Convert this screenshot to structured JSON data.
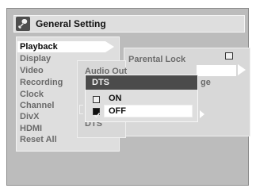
{
  "title": "General Setting",
  "main_menu": [
    {
      "label": "Playback"
    },
    {
      "label": "Display"
    },
    {
      "label": "Video"
    },
    {
      "label": "Recording"
    },
    {
      "label": "Clock"
    },
    {
      "label": "Channel"
    },
    {
      "label": "DivX"
    },
    {
      "label": "HDMI"
    },
    {
      "label": "Reset All"
    }
  ],
  "playback_submenu": {
    "audio_out_partial": "Audio Out",
    "dts_label": "DTS",
    "parental_lock": "Parental Lock",
    "partial_text": "ge"
  },
  "dts_popup": {
    "title": "DTS",
    "options": [
      {
        "label": "ON",
        "checked": false
      },
      {
        "label": "OFF",
        "checked": true
      }
    ]
  }
}
